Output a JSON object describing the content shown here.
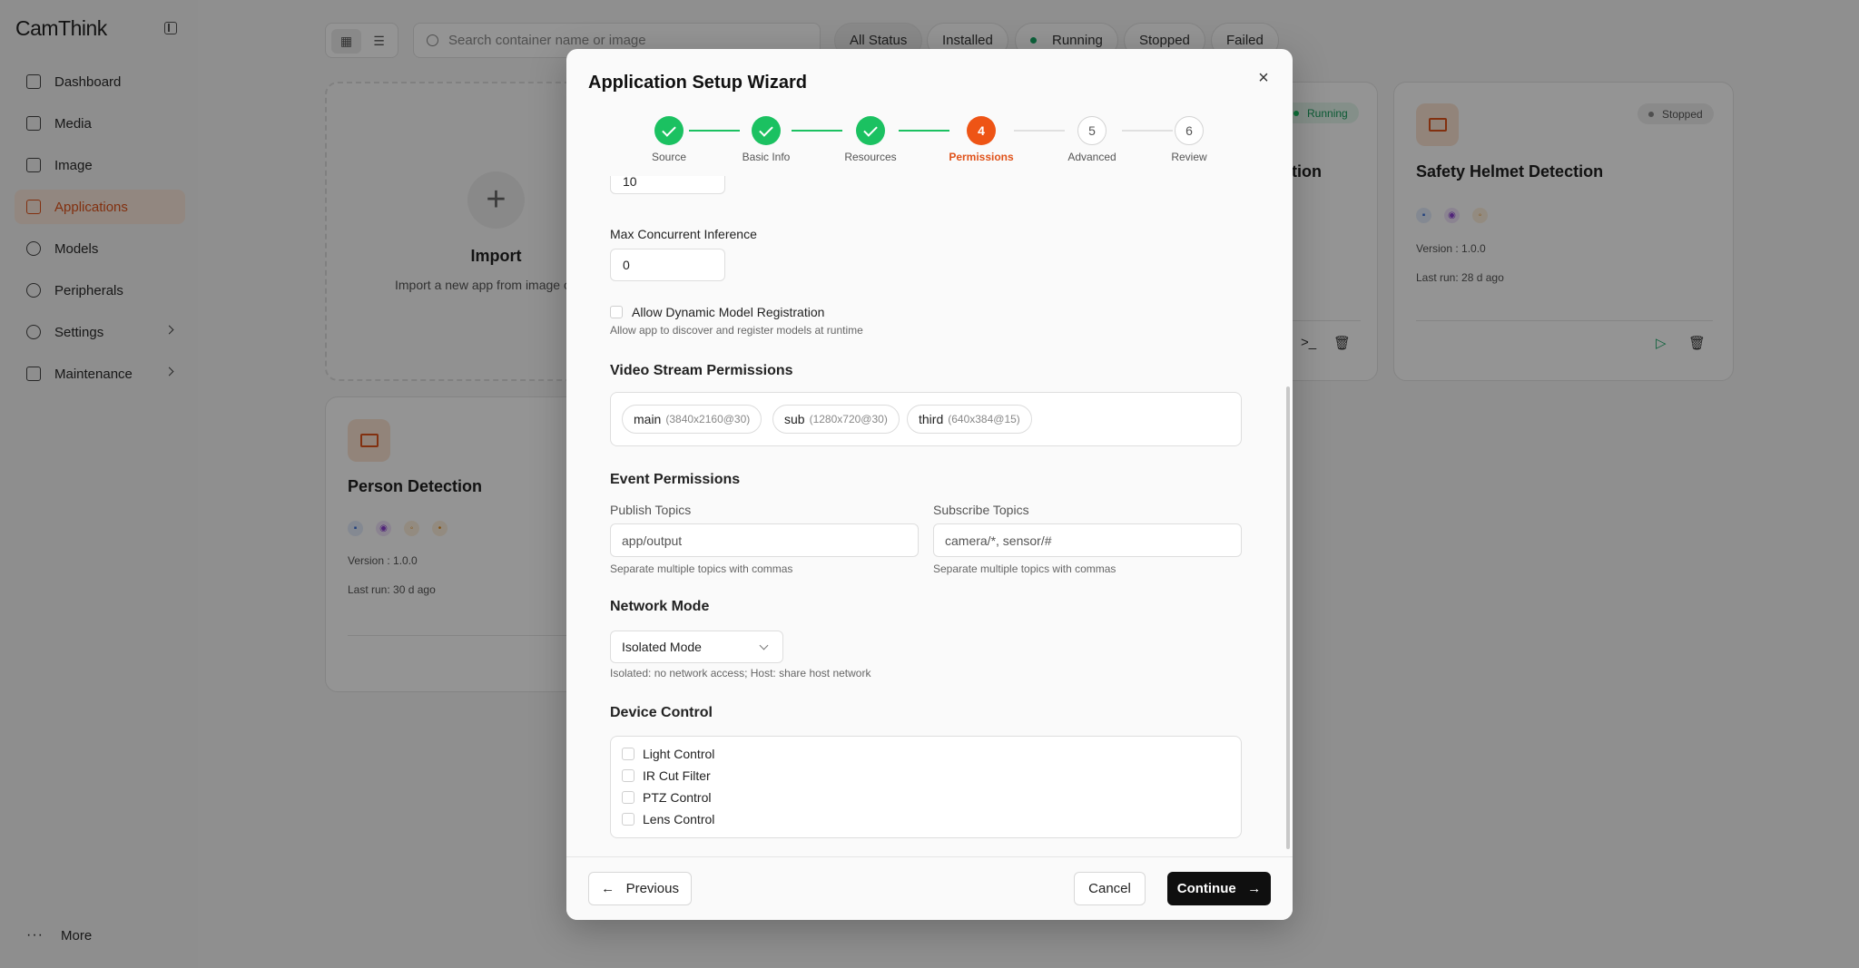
{
  "sidebar": {
    "brand": "CamThink",
    "items": [
      {
        "label": "Dashboard"
      },
      {
        "label": "Media"
      },
      {
        "label": "Image"
      },
      {
        "label": "Applications"
      },
      {
        "label": "Models"
      },
      {
        "label": "Peripherals"
      },
      {
        "label": "Settings"
      },
      {
        "label": "Maintenance"
      }
    ],
    "more_label": "More"
  },
  "toolbar": {
    "search_placeholder": "Search container name or image",
    "filters": [
      "All Status",
      "Installed",
      "Running",
      "Stopped",
      "Failed"
    ]
  },
  "cards": {
    "import": {
      "title": "Import",
      "subtitle": "Import a new app from image or"
    },
    "helmet": {
      "title": "Safety Helmet Detection",
      "status": "Stopped",
      "version": "Version : 1.0.0",
      "last_run": "Last run: 28 d ago"
    },
    "running": {
      "title_fragment": "ction",
      "status": "Running"
    },
    "person": {
      "title": "Person Detection",
      "version": "Version : 1.0.0",
      "last_run": "Last run: 30 d ago"
    }
  },
  "modal": {
    "title": "Application Setup Wizard",
    "steps": [
      {
        "num": "1",
        "label": "Source",
        "state": "done"
      },
      {
        "num": "2",
        "label": "Basic Info",
        "state": "done"
      },
      {
        "num": "3",
        "label": "Resources",
        "state": "done"
      },
      {
        "num": "4",
        "label": "Permissions",
        "state": "current"
      },
      {
        "num": "5",
        "label": "Advanced",
        "state": "todo"
      },
      {
        "num": "6",
        "label": "Review",
        "state": "todo"
      }
    ],
    "prev_input_value": "10",
    "max_concurrent": {
      "label": "Max Concurrent Inference",
      "value": "0"
    },
    "dynamic_model": {
      "label": "Allow Dynamic Model Registration",
      "hint": "Allow app to discover and register models at runtime"
    },
    "video_stream": {
      "title": "Video Stream Permissions",
      "streams": [
        {
          "name": "main",
          "res": "(3840x2160@30)"
        },
        {
          "name": "sub",
          "res": "(1280x720@30)"
        },
        {
          "name": "third",
          "res": "(640x384@15)"
        }
      ]
    },
    "events": {
      "title": "Event Permissions",
      "publish_label": "Publish Topics",
      "publish_placeholder": "app/output",
      "publish_hint": "Separate multiple topics with commas",
      "subscribe_label": "Subscribe Topics",
      "subscribe_placeholder": "camera/*, sensor/#",
      "subscribe_hint": "Separate multiple topics with commas"
    },
    "network": {
      "title": "Network Mode",
      "value": "Isolated Mode",
      "hint": "Isolated: no network access; Host: share host network"
    },
    "device": {
      "title": "Device Control",
      "items": [
        "Light Control",
        "IR Cut Filter",
        "PTZ Control",
        "Lens Control"
      ]
    },
    "footer": {
      "previous": "Previous",
      "cancel": "Cancel",
      "continue": "Continue"
    }
  }
}
